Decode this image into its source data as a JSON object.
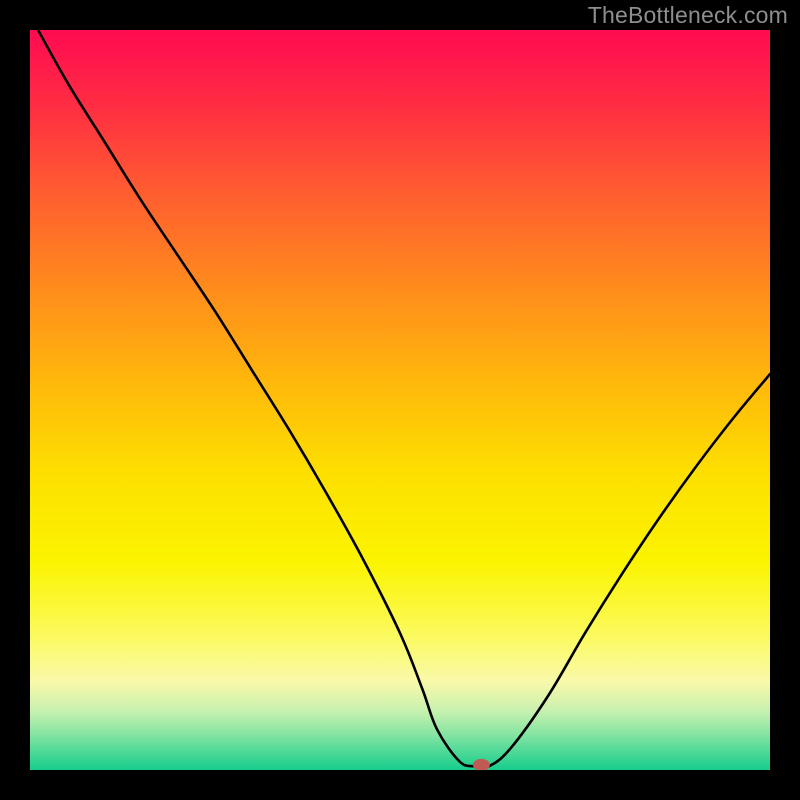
{
  "watermark": "TheBottleneck.com",
  "chart_data": {
    "type": "line",
    "title": "",
    "xlabel": "",
    "ylabel": "",
    "xlim": [
      0,
      100
    ],
    "ylim": [
      0,
      100
    ],
    "grid": false,
    "legend": false,
    "series": [
      {
        "name": "bottleneck-curve",
        "x": [
          0,
          5,
          10,
          15,
          20,
          25,
          30,
          35,
          40,
          45,
          50,
          53,
          55,
          58,
          60,
          62,
          65,
          70,
          75,
          80,
          85,
          90,
          95,
          100
        ],
        "y": [
          102,
          93,
          85,
          77,
          69.5,
          62,
          54,
          46,
          37.5,
          28.5,
          18.5,
          11,
          5.5,
          1.2,
          0.5,
          0.5,
          3,
          10,
          18.5,
          26.5,
          34,
          41,
          47.5,
          53.5
        ],
        "color": "#000000"
      }
    ],
    "marker": {
      "name": "optimal-point",
      "x": 61,
      "y": 0.7,
      "color": "#c05a52"
    },
    "background": {
      "type": "vertical-gradient",
      "stops": [
        {
          "pos": 0.0,
          "color": "#ff0b51"
        },
        {
          "pos": 0.1,
          "color": "#ff2c43"
        },
        {
          "pos": 0.22,
          "color": "#ff5d30"
        },
        {
          "pos": 0.35,
          "color": "#ff8c1c"
        },
        {
          "pos": 0.48,
          "color": "#ffb90b"
        },
        {
          "pos": 0.6,
          "color": "#fde000"
        },
        {
          "pos": 0.72,
          "color": "#fbf400"
        },
        {
          "pos": 0.82,
          "color": "#fbfa60"
        },
        {
          "pos": 0.88,
          "color": "#faf9aa"
        },
        {
          "pos": 0.92,
          "color": "#c8f1af"
        },
        {
          "pos": 0.95,
          "color": "#8ae5a3"
        },
        {
          "pos": 0.975,
          "color": "#4fd998"
        },
        {
          "pos": 1.0,
          "color": "#16cd8c"
        }
      ]
    }
  }
}
